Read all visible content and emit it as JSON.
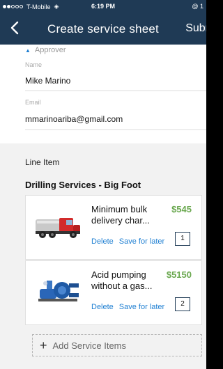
{
  "status_bar": {
    "carrier": "T-Mobile",
    "time": "6:19 PM",
    "right_icons": "@ 1"
  },
  "nav": {
    "title": "Create service sheet",
    "submit_label": "Subm"
  },
  "approver": {
    "section_label": "Approver",
    "name_label": "Name",
    "name_value": "Mike Marino",
    "email_label": "Email",
    "email_value": "mmarinoariba@gmail.com"
  },
  "line_item": {
    "section_title": "Line Item",
    "group_title": "Drilling Services - Big Foot",
    "items": [
      {
        "description": "Minimum bulk delivery char...",
        "price": "$545",
        "delete_label": "Delete",
        "save_label": "Save for later",
        "quantity": "1",
        "thumb_icon": "truck-icon"
      },
      {
        "description": "Acid pumping without a gas...",
        "price": "$5150",
        "delete_label": "Delete",
        "save_label": "Save for later",
        "quantity": "2",
        "thumb_icon": "pump-icon"
      }
    ],
    "add_label": "Add Service Items"
  },
  "colors": {
    "header_bg": "#1f3a55",
    "accent": "#1e7fd2",
    "price": "#6aa84f"
  }
}
